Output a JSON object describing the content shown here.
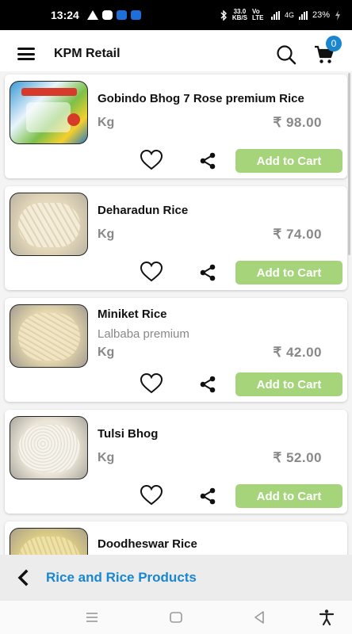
{
  "status": {
    "time": "13:24",
    "speed_top": "33.0",
    "speed_bottom": "KB/S",
    "volte": "Vo LTE",
    "network": "4G",
    "battery": "23%"
  },
  "appbar": {
    "title": "KPM Retail",
    "cart_count": "0"
  },
  "products": [
    {
      "name": "Gobindo Bhog 7 Rose premium Rice",
      "subtitle": "",
      "unit": "Kg",
      "price": "₹ 98.00",
      "button": "Add to Cart"
    },
    {
      "name": "Deharadun Rice",
      "subtitle": "",
      "unit": "Kg",
      "price": "₹ 74.00",
      "button": "Add to Cart"
    },
    {
      "name": "Miniket Rice",
      "subtitle": "Lalbaba premium",
      "unit": "Kg",
      "price": "₹ 42.00",
      "button": "Add to Cart"
    },
    {
      "name": "Tulsi Bhog",
      "subtitle": "",
      "unit": "Kg",
      "price": "₹ 52.00",
      "button": "Add to Cart"
    },
    {
      "name": "Doodheswar Rice",
      "subtitle": "",
      "unit": "",
      "price": "",
      "button": ""
    }
  ],
  "category": {
    "title": "Rice and Rice Products"
  },
  "colors": {
    "accent": "#1a86d0",
    "add_button": "#a5d47b",
    "muted_text": "#888888"
  },
  "icons": [
    "menu-icon",
    "search-icon",
    "cart-icon",
    "heart-icon",
    "share-icon",
    "back-arrow-icon",
    "nav-recents-icon",
    "nav-home-icon",
    "nav-back-icon",
    "accessibility-icon"
  ]
}
